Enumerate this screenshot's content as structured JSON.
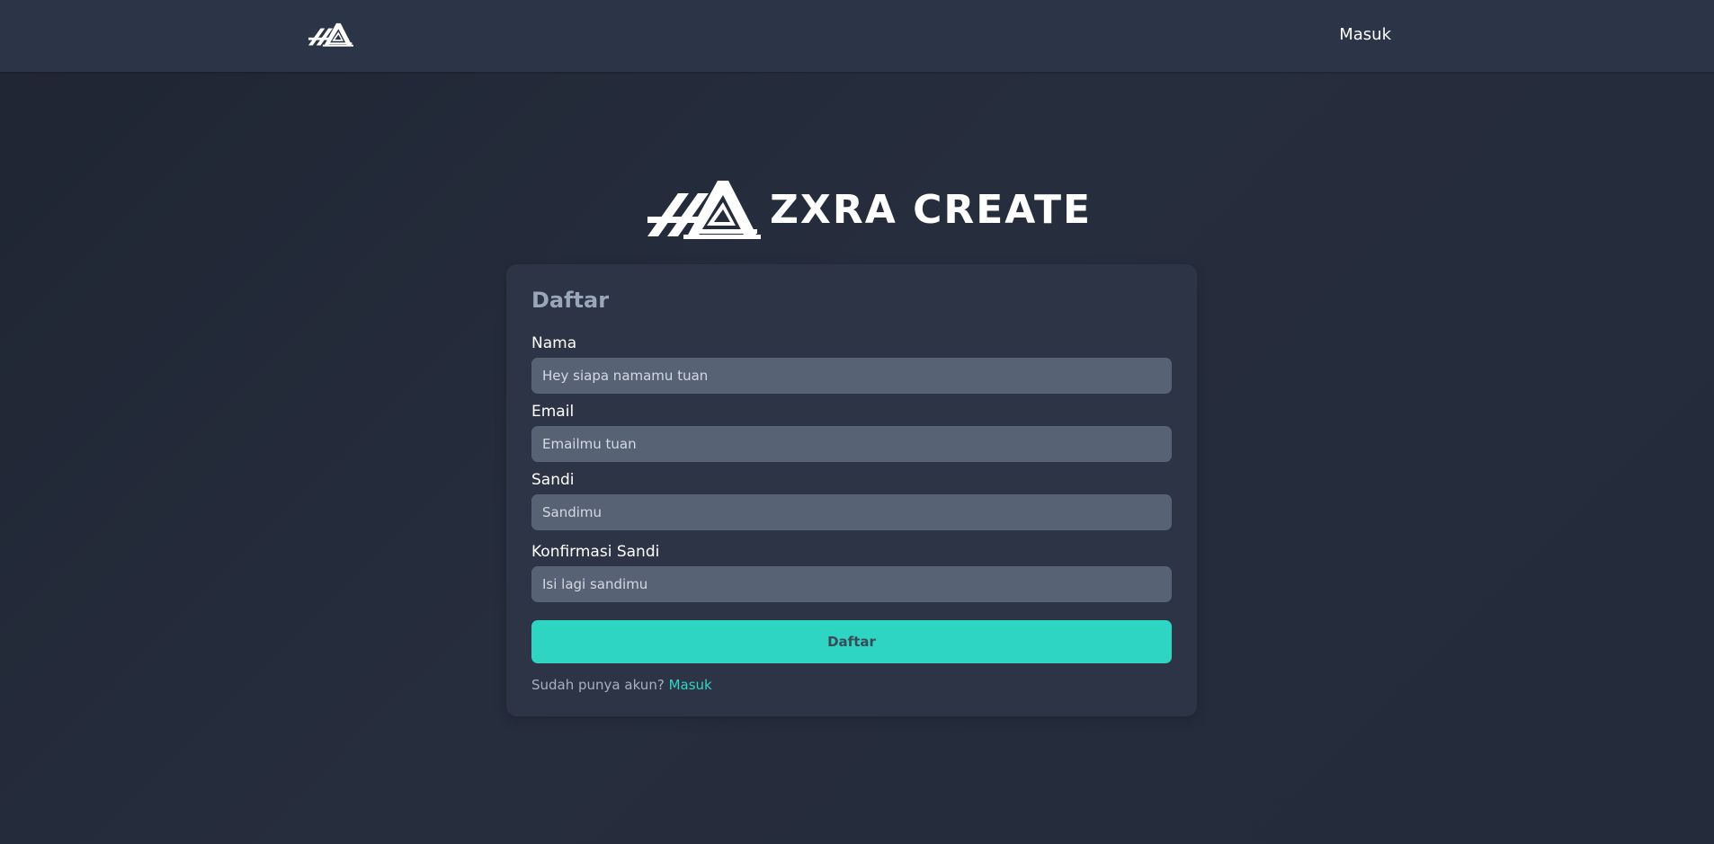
{
  "navbar": {
    "logo_icon": "zxra-logo-icon",
    "login_link": "Masuk"
  },
  "brand": {
    "logo_icon": "zxra-logo-icon",
    "name": "ZXRA CREATE"
  },
  "form": {
    "title": "Daftar",
    "fields": [
      {
        "label": "Nama",
        "placeholder": "Hey siapa namamu tuan",
        "value": ""
      },
      {
        "label": "Email",
        "placeholder": "Emailmu tuan",
        "value": ""
      },
      {
        "label": "Sandi",
        "placeholder": "Sandimu",
        "value": ""
      },
      {
        "label": "Konfirmasi Sandi",
        "placeholder": "Isi lagi sandimu",
        "value": ""
      }
    ],
    "submit_label": "Daftar",
    "footer_text": "Sudah punya akun?",
    "footer_link": "Masuk"
  },
  "colors": {
    "accent": "#2fd5c3",
    "navbar_bg": "#2c3447",
    "card_bg": "#2d3446",
    "input_bg": "#576275",
    "title_muted": "#9aa6bc"
  }
}
